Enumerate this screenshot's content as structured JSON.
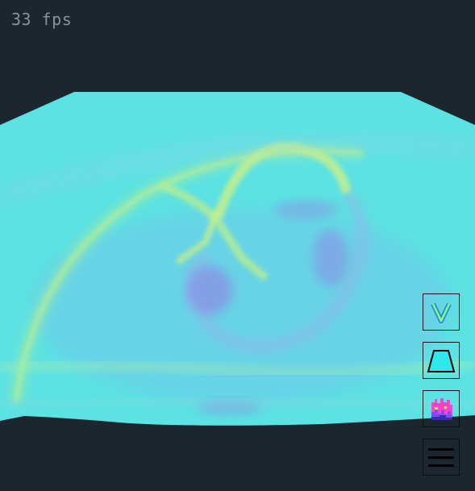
{
  "status": {
    "fps_label": "33 fps"
  },
  "colors": {
    "background": "#1b262f",
    "surface_base": "#5ce0e0",
    "ridge": "#c6f08a",
    "trough": "#8a8ae8"
  },
  "toolbar": {
    "buttons": [
      {
        "name": "color-scale-button",
        "icon": "v-gradient-icon"
      },
      {
        "name": "projection-button",
        "icon": "trapezoid-icon"
      },
      {
        "name": "histogram-button",
        "icon": "histogram-icon"
      },
      {
        "name": "menu-button",
        "icon": "hamburger-menu-icon"
      }
    ]
  }
}
